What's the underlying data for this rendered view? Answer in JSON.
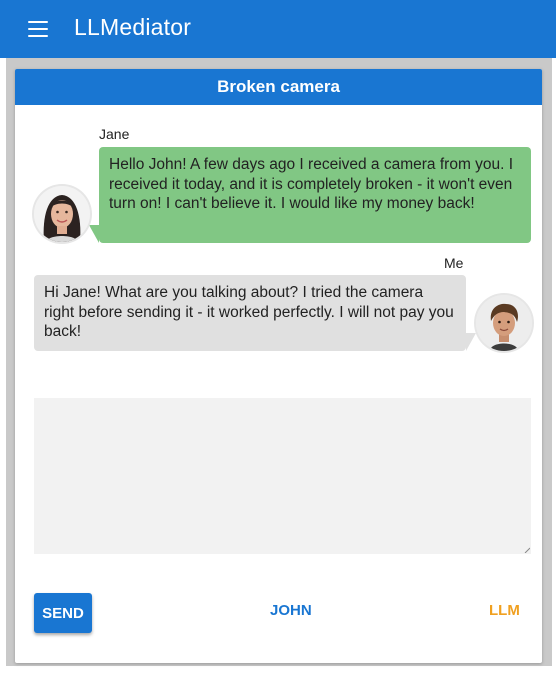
{
  "app": {
    "title_prefix": "LL",
    "title_rest": "Mediator"
  },
  "conversation": {
    "title": "Broken camera",
    "messages": [
      {
        "sender": "Jane",
        "avatar": "woman-avatar",
        "side": "left",
        "color": "#81c784",
        "text": "Hello John! A few days ago I received a camera from you. I received it today, and it is completely broken - it won't even turn on! I can't believe it. I would like my money back!"
      },
      {
        "sender": "Me",
        "avatar": "man-avatar",
        "side": "right",
        "color": "#e0e0e0",
        "text": "Hi Jane! What are you talking about? I tried the camera right before sending it - it worked perfectly. I will not pay you back!"
      }
    ]
  },
  "compose": {
    "value": "",
    "placeholder": ""
  },
  "actions": {
    "send_label": "SEND",
    "john_label": "JOHN",
    "llm_label": "LLM"
  },
  "colors": {
    "primary": "#1976d2",
    "llm_accent": "#f0a020",
    "frame": "#c9c9c9"
  }
}
